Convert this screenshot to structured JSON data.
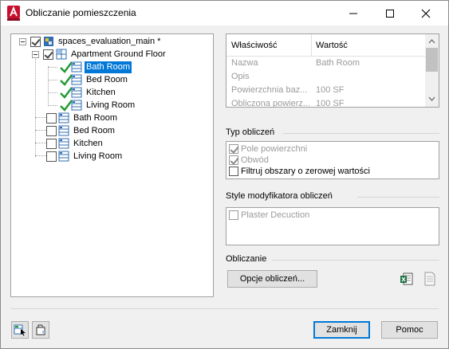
{
  "window": {
    "title": "Obliczanie pomieszczenia"
  },
  "tree": {
    "root": {
      "label": "spaces_evaluation_main *",
      "checked": true
    },
    "floor": {
      "label": "Apartment Ground Floor",
      "checked": true
    },
    "floor_rooms": [
      {
        "label": "Bath Room",
        "selected": true
      },
      {
        "label": "Bed Room",
        "selected": false
      },
      {
        "label": "Kitchen",
        "selected": false
      },
      {
        "label": "Living Room",
        "selected": false
      }
    ],
    "other_rooms": [
      {
        "label": "Bath Room",
        "checked": false
      },
      {
        "label": "Bed Room",
        "checked": false
      },
      {
        "label": "Kitchen",
        "checked": false
      },
      {
        "label": "Living Room",
        "checked": false
      }
    ]
  },
  "properties": {
    "col_property": "Właściwość",
    "col_value": "Wartość",
    "rows": [
      {
        "name": "Nazwa",
        "value": "Bath Room"
      },
      {
        "name": "Opis",
        "value": ""
      },
      {
        "name": "Powierzchnia baz...",
        "value": "100  SF"
      },
      {
        "name": "Obliczona powierz...",
        "value": "100  SF"
      }
    ]
  },
  "calc_type": {
    "label": "Typ obliczeń",
    "options": [
      {
        "label": "Pole powierzchni",
        "checked": true,
        "enabled": false
      },
      {
        "label": "Obwód",
        "checked": true,
        "enabled": false
      },
      {
        "label": "Filtruj obszary o zerowej wartości",
        "checked": false,
        "enabled": true
      }
    ]
  },
  "modifier_styles": {
    "label": "Style modyfikatora obliczeń",
    "options": [
      {
        "label": "Plaster Decuction",
        "checked": false,
        "enabled": false
      }
    ]
  },
  "calculation": {
    "label": "Obliczanie",
    "options_button": "Opcje obliczeń..."
  },
  "footer": {
    "close_button": "Zamknij",
    "help_button": "Pomoc"
  },
  "colors": {
    "selection": "#0078d7",
    "app_icon": "#c8102e",
    "check_green": "#1f9a2f"
  }
}
